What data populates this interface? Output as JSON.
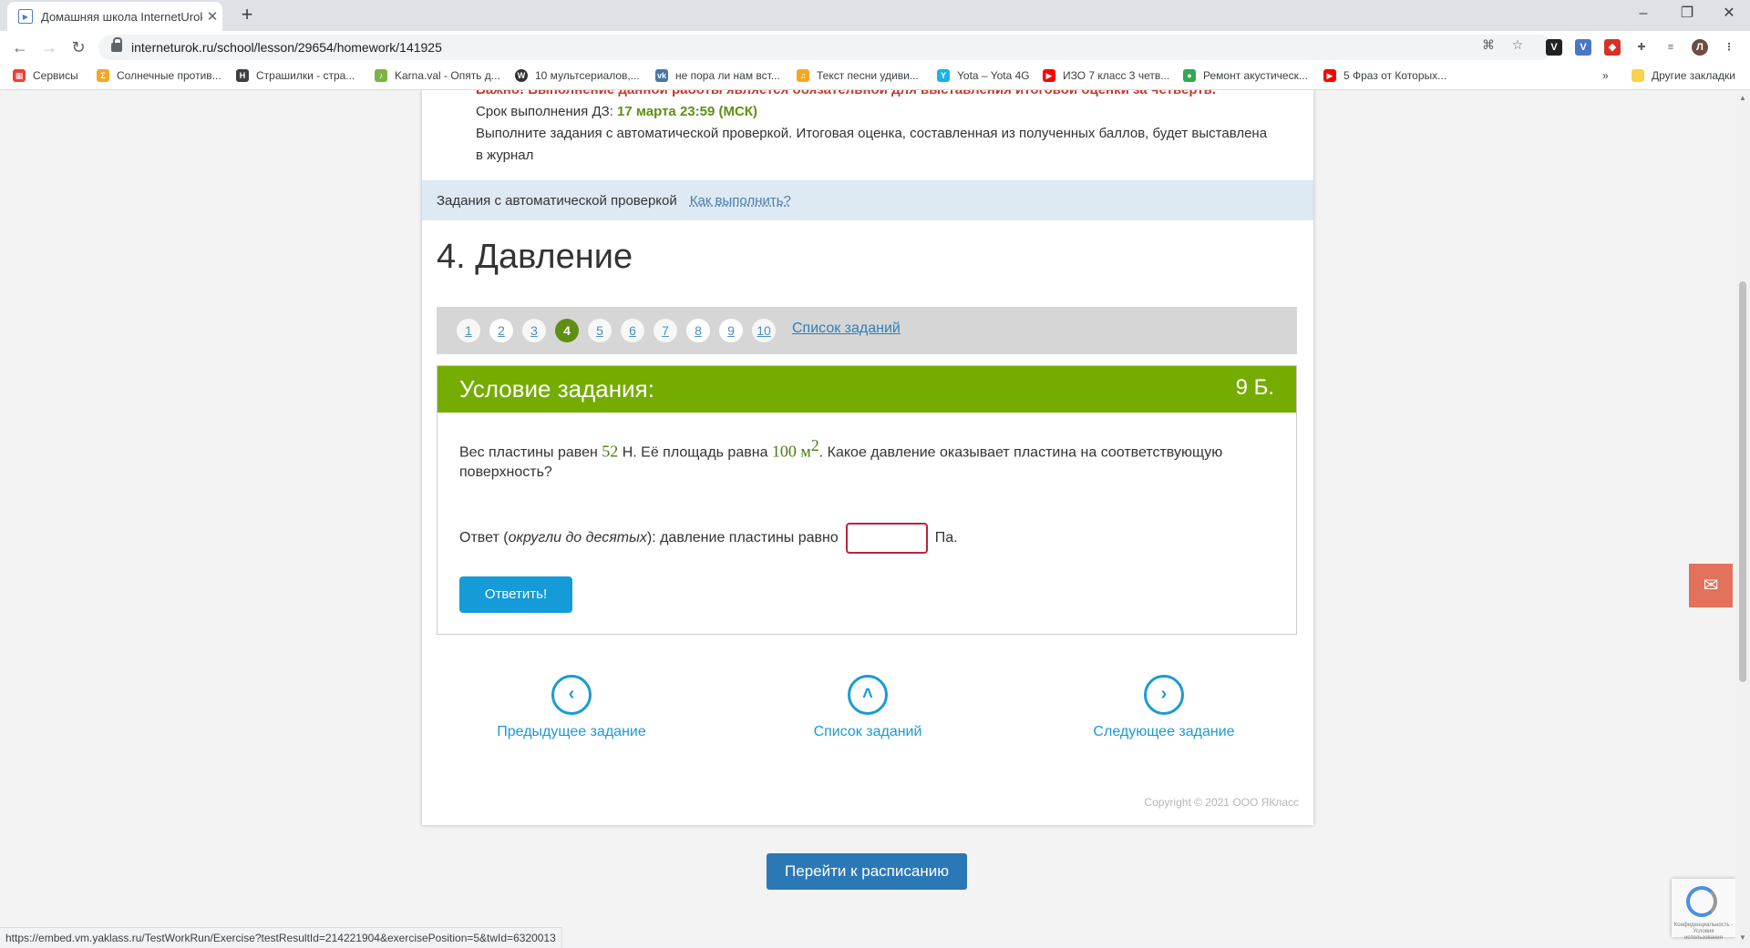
{
  "browser": {
    "tab_title": "Домашняя школа InternetUrok.r",
    "url": "interneturok.ru/school/lesson/29654/homework/141925",
    "bookmarks": [
      {
        "label": "Сервисы",
        "color": "#e94235"
      },
      {
        "label": "Солнечные против...",
        "color": "#f5a623"
      },
      {
        "label": "Страшилки - стра...",
        "color": "#3c4043"
      },
      {
        "label": "Karna.val - Опять д...",
        "color": "#7cb342"
      },
      {
        "label": "10 мультсериалов,...",
        "color": "#333333"
      },
      {
        "label": "не пора ли нам вст...",
        "color": "#4a76a8"
      },
      {
        "label": "Текст песни удиви...",
        "color": "#f5a623"
      },
      {
        "label": "Yota – Yota 4G",
        "color": "#1ab2e8"
      },
      {
        "label": "ИЗО 7 класс 3 четв...",
        "color": "#ff0000"
      },
      {
        "label": "Ремонт акустическ...",
        "color": "#34a853"
      },
      {
        "label": "5 Фраз от Которых...",
        "color": "#ff0000"
      }
    ],
    "other_bookmarks": "Другие закладки",
    "status_url": "https://embed.vm.yaklass.ru/TestWorkRun/Exercise?testResultId=214221904&exercisePosition=5&twId=6320013"
  },
  "page": {
    "cut_line": "Важно! Выполнение данной работы является обязательной для выставления итоговой оценки за четверть.",
    "deadline_label": "Срок выполнения ДЗ:",
    "deadline_value": "17 марта 23:59 (МСК)",
    "instructions_1": "Выполните задания с автоматической проверкой. Итоговая оценка, составленная из полученных баллов, будет выставлена",
    "instructions_2": "в журнал",
    "auto_bar_label": "Задания с автоматической проверкой",
    "auto_bar_link": "Как выполнить?",
    "title": "4. Давление",
    "task_numbers": [
      "1",
      "2",
      "3",
      "4",
      "5",
      "6",
      "7",
      "8",
      "9",
      "10"
    ],
    "current_task": "4",
    "task_list_link": "Список заданий",
    "condition_header": "Условие задания:",
    "points": "9 Б.",
    "condition": {
      "p1": "Вес пластины равен ",
      "weight": "52",
      "p2": " Н. Её площадь равна ",
      "area": "100",
      "unit": "м",
      "power": "2",
      "p3": ". Какое давление оказывает пластина на соответствующую поверхность?"
    },
    "answer": {
      "prefix": "Ответ (",
      "hint": "округли до десятых",
      "suffix": "): давление пластины равно",
      "value": "",
      "unit": "Па."
    },
    "answer_button": "Ответить!",
    "nav": {
      "prev": "Предыдущее задание",
      "list": "Список заданий",
      "next": "Следующее задание"
    },
    "copyright": "Copyright © 2021 ООО ЯКласс",
    "schedule_button": "Перейти к расписанию",
    "recaptcha_text": "Конфиденциальность - Условия использования"
  },
  "colors": {
    "header_green": "#75ac00",
    "active_task": "#5f8f12",
    "answer_button": "#159bd8",
    "schedule_button": "#2b78b7",
    "chat_button": "#e2725b"
  }
}
